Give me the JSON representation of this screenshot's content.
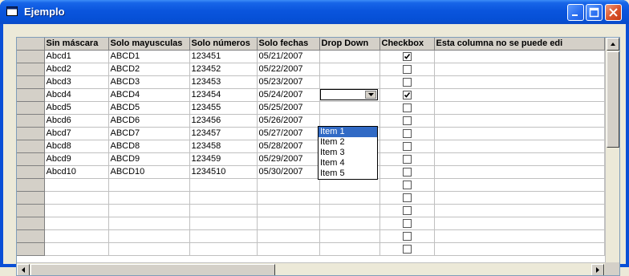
{
  "window": {
    "title": "Ejemplo"
  },
  "grid": {
    "columns": [
      "Sin máscara",
      "Solo mayusculas",
      "Solo números",
      "Solo fechas",
      "Drop Down",
      "Checkbox",
      "Esta columna no se puede edi"
    ],
    "rows": [
      {
        "c0": "Abcd1",
        "c1": "ABCD1",
        "c2": "123451",
        "c3": "05/21/2007",
        "c4": "",
        "checked": true
      },
      {
        "c0": "Abcd2",
        "c1": "ABCD2",
        "c2": "123452",
        "c3": "05/22/2007",
        "c4": "",
        "checked": false
      },
      {
        "c0": "Abcd3",
        "c1": "ABCD3",
        "c2": "123453",
        "c3": "05/23/2007",
        "c4": "",
        "checked": false
      },
      {
        "c0": "Abcd4",
        "c1": "ABCD4",
        "c2": "123454",
        "c3": "05/24/2007",
        "c4": "",
        "checked": true
      },
      {
        "c0": "Abcd5",
        "c1": "ABCD5",
        "c2": "123455",
        "c3": "05/25/2007",
        "c4": "",
        "checked": false
      },
      {
        "c0": "Abcd6",
        "c1": "ABCD6",
        "c2": "123456",
        "c3": "05/26/2007",
        "c4": "",
        "checked": false
      },
      {
        "c0": "Abcd7",
        "c1": "ABCD7",
        "c2": "123457",
        "c3": "05/27/2007",
        "c4": "",
        "checked": false
      },
      {
        "c0": "Abcd8",
        "c1": "ABCD8",
        "c2": "123458",
        "c3": "05/28/2007",
        "c4": "",
        "checked": false
      },
      {
        "c0": "Abcd9",
        "c1": "ABCD9",
        "c2": "123459",
        "c3": "05/29/2007",
        "c4": "",
        "checked": false
      },
      {
        "c0": "Abcd10",
        "c1": "ABCD10",
        "c2": "1234510",
        "c3": "05/30/2007",
        "c4": "",
        "checked": false
      }
    ],
    "empty_rows": 6
  },
  "dropdown": {
    "items": [
      "Item 1",
      "Item 2",
      "Item 3",
      "Item 4",
      "Item 5"
    ],
    "selected": "Item 1"
  },
  "colors": {
    "titlebar": "#0a55dd",
    "selection": "#316ac5",
    "header": "#d4d0c8"
  }
}
